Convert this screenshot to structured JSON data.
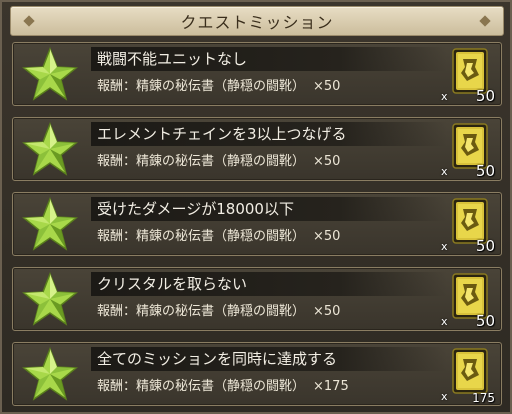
{
  "header": {
    "title": "クエストミッション"
  },
  "missions": [
    {
      "title": "戦闘不能ユニットなし",
      "reward_label": "報酬：精錬の秘伝書（静穏の闘靴）",
      "reward_qty": "×50",
      "item_count": "50",
      "item_prefix": "x"
    },
    {
      "title": "エレメントチェインを3以上つなげる",
      "reward_label": "報酬：精錬の秘伝書（静穏の闘靴）",
      "reward_qty": "×50",
      "item_count": "50",
      "item_prefix": "x"
    },
    {
      "title": "受けたダメージが18000以下",
      "reward_label": "報酬：精錬の秘伝書（静穏の闘靴）",
      "reward_qty": "×50",
      "item_count": "50",
      "item_prefix": "x"
    },
    {
      "title": "クリスタルを取らない",
      "reward_label": "報酬：精錬の秘伝書（静穏の闘靴）",
      "reward_qty": "×50",
      "item_count": "50",
      "item_prefix": "x"
    },
    {
      "title": "全てのミッションを同時に達成する",
      "reward_label": "報酬：精錬の秘伝書（静穏の闘靴）",
      "reward_qty": "×175",
      "item_count": "175",
      "item_prefix": "x"
    }
  ],
  "colors": {
    "star_fill": "#a8d84a",
    "star_light": "#d6f28a",
    "star_dark": "#6a9a22",
    "book_gold": "#d8c23a",
    "title_text": "#f2eee4"
  },
  "icons": {
    "mission_status": "green-star-icon",
    "reward_item": "gold-book-icon"
  }
}
